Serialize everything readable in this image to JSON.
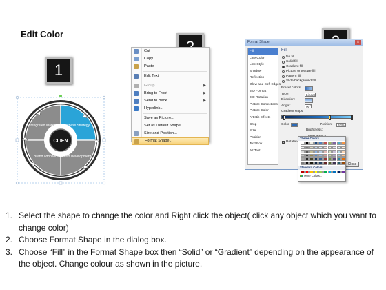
{
  "title": "Edit Color",
  "steps": [
    "1",
    "2",
    "3"
  ],
  "diagram": {
    "center": "CLIEN",
    "segments": [
      "Integrated Marketing",
      "Business Strategy",
      "Brand adoption",
      "Brand Development"
    ],
    "colors": {
      "highlight": "#2aa4d8",
      "segment": "#8c8c8c",
      "ring": "#2e2e2e",
      "center": "#1a1a1a"
    }
  },
  "context_menu": {
    "items": [
      {
        "label": "Cut",
        "icon": "scissors-icon"
      },
      {
        "label": "Copy",
        "icon": "copy-icon"
      },
      {
        "label": "Paste",
        "icon": "paste-icon"
      },
      {
        "sep": true
      },
      {
        "label": "Edit Text",
        "icon": "edit-text-icon"
      },
      {
        "sep": true
      },
      {
        "label": "Group",
        "icon": "group-icon",
        "disabled": true,
        "sub": true
      },
      {
        "label": "Bring to Front",
        "icon": "bring-front-icon",
        "sub": true
      },
      {
        "label": "Send to Back",
        "icon": "send-back-icon",
        "sub": true
      },
      {
        "label": "Hyperlink...",
        "icon": "hyperlink-icon"
      },
      {
        "sep": true
      },
      {
        "label": "Save as Picture...",
        "icon": ""
      },
      {
        "label": "Set as Default Shape",
        "icon": ""
      },
      {
        "label": "Size and Position...",
        "icon": "size-position-icon"
      },
      {
        "label": "Format Shape...",
        "icon": "format-shape-icon",
        "highlight": true
      }
    ]
  },
  "format_dialog": {
    "title": "Format Shape",
    "close_glyph": "✕",
    "nav": [
      "Fill",
      "Line Color",
      "Line Style",
      "Shadow",
      "Reflection",
      "Glow and Soft Edges",
      "3-D Format",
      "3-D Rotation",
      "Picture Corrections",
      "Picture Color",
      "Artistic Effects",
      "Crop",
      "Size",
      "Position",
      "Text Box",
      "Alt Text"
    ],
    "section": "Fill",
    "fill_options": [
      {
        "label": "No fill",
        "checked": false
      },
      {
        "label": "Solid fill",
        "checked": false
      },
      {
        "label": "Gradient fill",
        "checked": true
      },
      {
        "label": "Picture or texture fill",
        "checked": false
      },
      {
        "label": "Pattern fill",
        "checked": false
      },
      {
        "label": "Slide background fill",
        "checked": false
      }
    ],
    "preset_colors_label": "Preset colors:",
    "type_label": "Type:",
    "type_value": "Linear",
    "direction_label": "Direction:",
    "angle_label": "Angle:",
    "angle_value": "90°",
    "gradient_stops_label": "Gradient stops",
    "color_label": "Color",
    "position_label": "Position:",
    "position_value": "67%",
    "brightness_label": "Brightness:",
    "transparency_label": "Transparency:",
    "rotate_label": "Rotate with shape",
    "close_button": "Close"
  },
  "palette": {
    "theme_label": "Theme Colors",
    "standard_label": "Standard Colors",
    "more_label": "More Colors...",
    "theme_top": [
      "#ffffff",
      "#000000",
      "#eeece1",
      "#1f497d",
      "#4f81bd",
      "#c0504d",
      "#9bbb59",
      "#8064a2",
      "#4bacc6",
      "#f79646"
    ],
    "theme_rows": [
      [
        "#f2f2f2",
        "#7f7f7f",
        "#ddd9c3",
        "#c6d9f0",
        "#dbe5f1",
        "#f2dcdb",
        "#ebf1dd",
        "#e5e0ec",
        "#dbeef3",
        "#fdeada"
      ],
      [
        "#d8d8d8",
        "#595959",
        "#c4bd97",
        "#8db3e2",
        "#b8cce4",
        "#e5b9b7",
        "#d7e3bc",
        "#ccc1d9",
        "#b7dde8",
        "#fbd5b5"
      ],
      [
        "#bfbfbf",
        "#3f3f3f",
        "#938953",
        "#548dd4",
        "#95b3d7",
        "#d99694",
        "#c3d69b",
        "#b2a2c7",
        "#92cddc",
        "#fac08f"
      ],
      [
        "#a5a5a5",
        "#262626",
        "#494429",
        "#17365d",
        "#366092",
        "#953734",
        "#76923c",
        "#5f497a",
        "#31859b",
        "#e36c09"
      ],
      [
        "#7f7f7f",
        "#0c0c0c",
        "#1d1b10",
        "#0f243e",
        "#244061",
        "#632423",
        "#4f6128",
        "#3f3151",
        "#205867",
        "#974806"
      ]
    ],
    "standard": [
      "#c00000",
      "#ff0000",
      "#ffc000",
      "#ffff00",
      "#92d050",
      "#00b050",
      "#00b0f0",
      "#0070c0",
      "#002060",
      "#7030a0"
    ]
  },
  "instructions": [
    {
      "num": "1.",
      "text": "Select the shape to change the color and Right click the object( click any object which you want to change color)"
    },
    {
      "num": "2.",
      "text": "Choose Format Shape in the dialog box."
    },
    {
      "num": "3.",
      "text": "Choose “Fill” in the Format Shape box then “Solid” or “Gradient” depending on the appearance of the object. Change colour as shown in the picture."
    }
  ]
}
